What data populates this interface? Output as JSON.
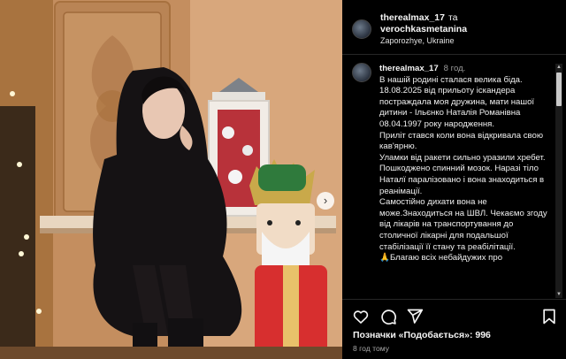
{
  "header": {
    "author": "therealmax_17",
    "and_word": "та",
    "coauthor": "verochkasmetanina",
    "location": "Zaporozhye, Ukraine"
  },
  "caption": {
    "username": "therealmax_17",
    "time": "8 год.",
    "paragraphs": [
      "В нашій родині сталася велика біда. 18.08.2025 від прильоту іскандера постраждала моя дружина, мати нашої дитини - Ільєнко Наталія Романівна 08.04.1997 року народження.",
      "Приліт стався коли вона відкривала свою кав'ярню.",
      "Уламки від ракети сильно уразили хребет. Пошкоджено спинний мозок. Наразі тіло Наталї паралізовано і вона знаходиться в реанімації.",
      "Самостійно дихати вона не може.Знаходиться на ШВЛ. Чекаємо згоду від лікарів на транспортування до столичної лікарні для подальшої стабілізації її стану та реабілітації.",
      "🙏Благаю всіх небайдужих про"
    ]
  },
  "actions": {
    "like_icon": "heart-icon",
    "comment_icon": "comment-icon",
    "share_icon": "share-icon",
    "save_icon": "bookmark-icon"
  },
  "likes": {
    "label": "Позначки «Подобається»:",
    "count": "996"
  },
  "posted": "8 год тому",
  "carousel": {
    "next_icon": "chevron-right-icon",
    "next_glyph": "›"
  },
  "colors": {
    "background": "#000000",
    "text": "#f5f5f5",
    "muted": "#a8a8a8",
    "divider": "#262626"
  }
}
